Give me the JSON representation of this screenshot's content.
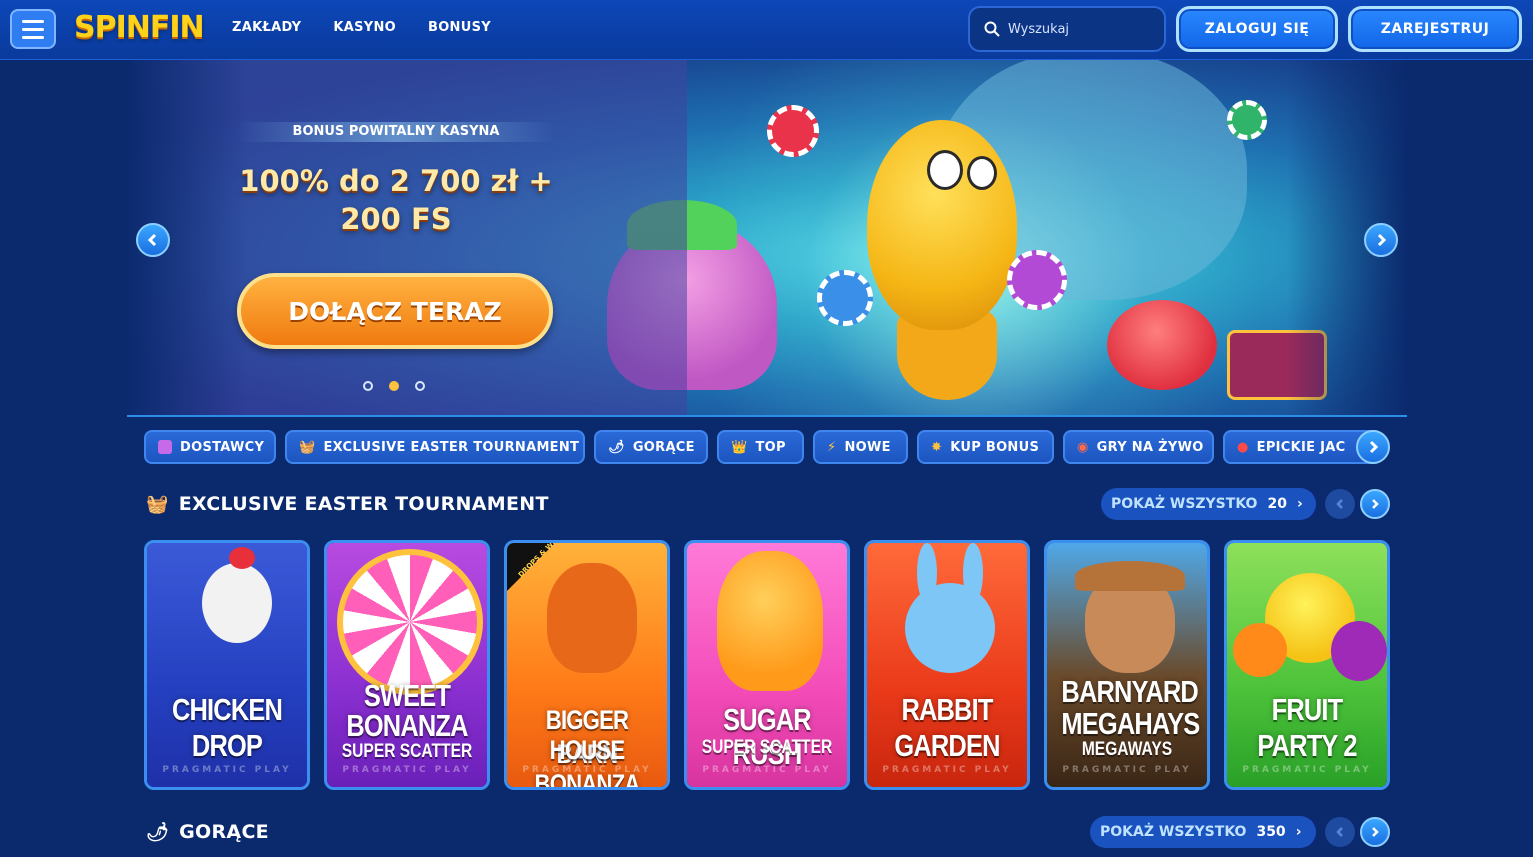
{
  "header": {
    "logo": "SPINFIN",
    "nav": [
      "ZAKŁADY",
      "KASYNO",
      "BONUSY"
    ],
    "search_placeholder": "Wyszukaj",
    "login_label": "ZALOGUJ SIĘ",
    "register_label": "ZAREJESTRUJ",
    "accent": "#ffd21a"
  },
  "hero": {
    "tag": "BONUS POWITALNY KASYNA",
    "line1": "100% do 2 700 zł +",
    "line2": "200 FS",
    "cta": "DOŁĄCZ TERAZ",
    "dots": 3,
    "active_dot": 1,
    "cta_color": "#f07a10"
  },
  "categories": [
    {
      "label": "DOSTAWCY",
      "icon": "provider-icon"
    },
    {
      "label": "EXCLUSIVE EASTER TOURNAMENT",
      "icon": "basket-icon"
    },
    {
      "label": "GORĄCE",
      "icon": "chili-icon"
    },
    {
      "label": "TOP",
      "icon": "crown-icon"
    },
    {
      "label": "NOWE",
      "icon": "lightning-icon"
    },
    {
      "label": "KUP BONUS",
      "icon": "star-icon"
    },
    {
      "label": "GRY NA ŻYWO",
      "icon": "roulette-icon"
    },
    {
      "label": "EPICKIE JAC",
      "icon": "bomb-icon"
    }
  ],
  "sections": [
    {
      "title": "EXCLUSIVE EASTER TOURNAMENT",
      "show_all": "POKAŻ WSZYSTKO",
      "count": "20",
      "icon": "basket-icon"
    },
    {
      "title": "GORĄCE",
      "show_all": "POKAŻ WSZYSTKO",
      "count": "350",
      "icon": "chili-icon"
    }
  ],
  "games": [
    {
      "title1": "CHICKEN",
      "title2": "DROP",
      "sub": "",
      "provider": "PRAGMATIC PLAY",
      "badge": ""
    },
    {
      "title1": "SWEET",
      "title2": "BONANZA",
      "sub": "SUPER SCATTER",
      "provider": "PRAGMATIC PLAY",
      "badge": ""
    },
    {
      "title1": "BIGGER BARN",
      "title2": "HOUSE BONANZA",
      "sub": "",
      "provider": "PRAGMATIC PLAY",
      "badge": "DROPS & WINS"
    },
    {
      "title1": "SUGAR RUSH",
      "title2": "",
      "sub": "SUPER SCATTER",
      "provider": "PRAGMATIC PLAY",
      "badge": ""
    },
    {
      "title1": "RABBIT",
      "title2": "GARDEN",
      "sub": "",
      "provider": "PRAGMATIC PLAY",
      "badge": ""
    },
    {
      "title1": "BARNYARD",
      "title2": "MEGAHAYS",
      "sub": "MEGAWAYS",
      "provider": "PRAGMATIC PLAY",
      "badge": ""
    },
    {
      "title1": "FRUIT",
      "title2": "PARTY 2",
      "sub": "",
      "provider": "PRAGMATIC PLAY",
      "badge": ""
    }
  ]
}
